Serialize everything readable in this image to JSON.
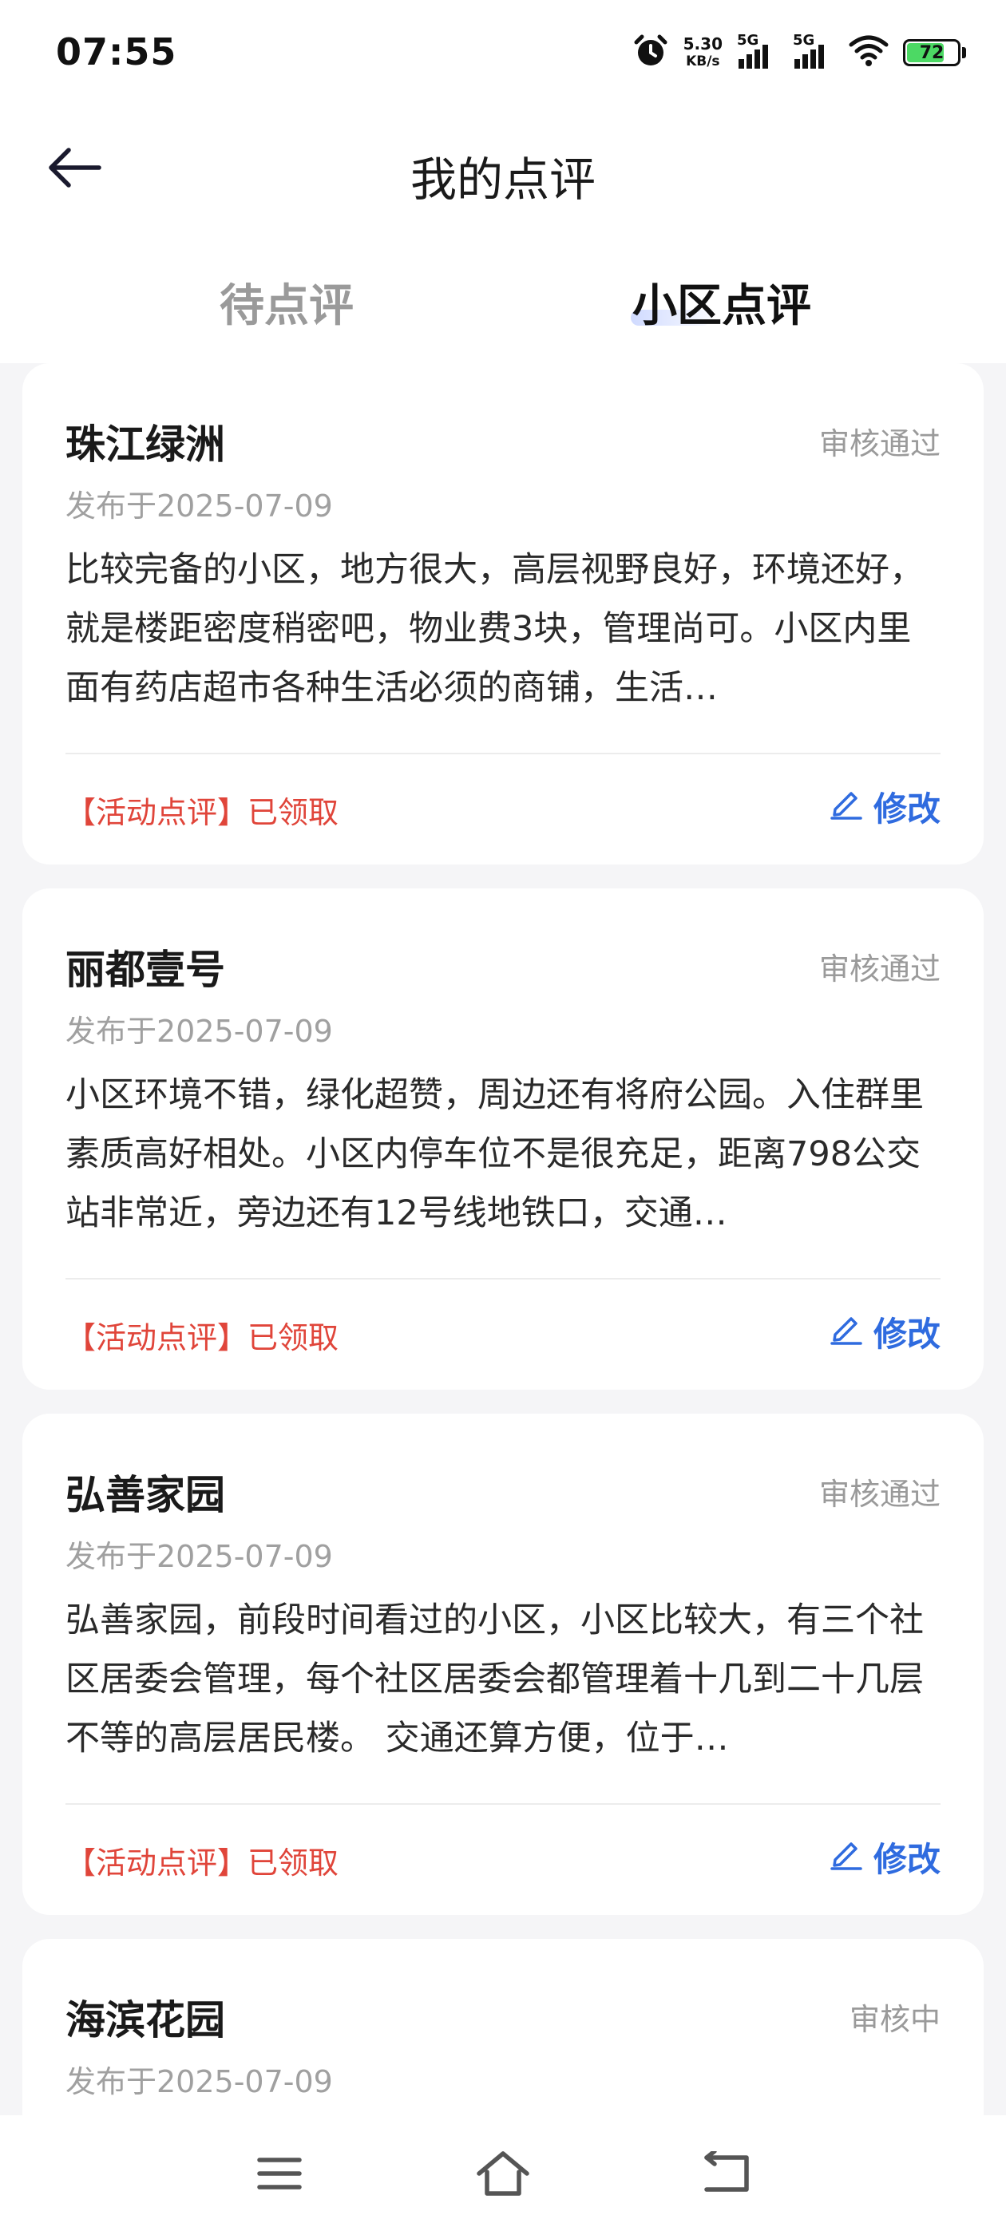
{
  "status_bar": {
    "time": "07:55",
    "net_speed_value": "5.30",
    "net_speed_unit": "KB/s",
    "sim1": "5G",
    "sim2": "5G",
    "battery": "72"
  },
  "header": {
    "title": "我的点评"
  },
  "tabs": [
    {
      "label": "待点评",
      "active": false
    },
    {
      "label": "小区点评",
      "active": true
    }
  ],
  "reviews": [
    {
      "name": "珠江绿洲",
      "status": "审核通过",
      "date": "发布于2025-07-09",
      "text": "比较完备的小区，地方很大，高层视野良好，环境还好，就是楼距密度稍密吧，物业费3块，管理尚可。小区内里面有药店超市各种生活必须的商铺，生活…",
      "tag": "【活动点评】已领取",
      "edit_label": "修改"
    },
    {
      "name": "丽都壹号",
      "status": "审核通过",
      "date": "发布于2025-07-09",
      "text": "小区环境不错，绿化超赞，周边还有将府公园。入住群里素质高好相处。小区内停车位不是很充足，距离798公交站非常近，旁边还有12号线地铁口，交通…",
      "tag": "【活动点评】已领取",
      "edit_label": "修改"
    },
    {
      "name": "弘善家园",
      "status": "审核通过",
      "date": "发布于2025-07-09",
      "text": "弘善家园，前段时间看过的小区，小区比较大，有三个社区居委会管理，每个社区居委会都管理着十几到二十几层不等的高层居民楼。 交通还算方便，位于…",
      "tag": "【活动点评】已领取",
      "edit_label": "修改"
    },
    {
      "name": "海滨花园",
      "status": "审核中",
      "date": "发布于2025-07-09"
    }
  ],
  "colors": {
    "accent_blue": "#2f6bdf",
    "tag_red": "#e0453a",
    "background": "#f5f5f7"
  },
  "icons": [
    "back-arrow-icon",
    "edit-pencil-icon",
    "menu-icon",
    "home-icon",
    "return-icon",
    "alarm-icon",
    "wifi-icon"
  ]
}
